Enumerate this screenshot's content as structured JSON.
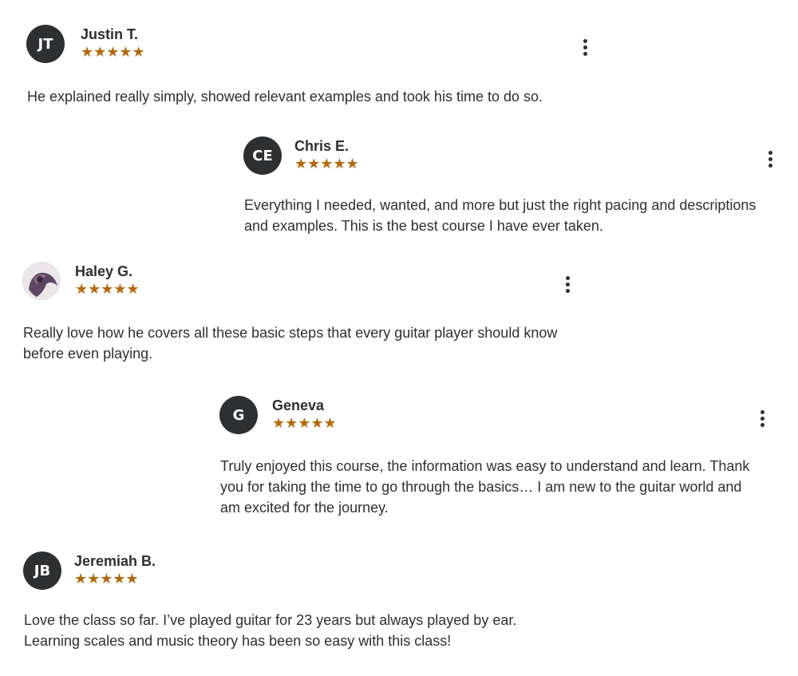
{
  "reviews": [
    {
      "initials": "JT",
      "name": "Justin T.",
      "rating": "★★★★★",
      "text": "He explained really simply, showed relevant examples and took his time to do so."
    },
    {
      "initials": "CE",
      "name": "Chris E.",
      "rating": "★★★★★",
      "text": "Everything I needed, wanted, and more but just the right pacing and descriptions\nand examples. This is the best course I have ever taken."
    },
    {
      "initials": "",
      "name": "Haley G.",
      "rating": "★★★★★",
      "text": "Really love how he covers all these basic steps that every guitar player should know\nbefore even playing."
    },
    {
      "initials": "G",
      "name": "Geneva",
      "rating": "★★★★★",
      "text": "Truly enjoyed this course, the information was easy to understand and learn. Thank\nyou for taking the time to go through the basics… I am new to the guitar world and\nam excited for the journey."
    },
    {
      "initials": "JB",
      "name": "Jeremiah B.",
      "rating": "★★★★★",
      "text": "Love the class so far. I’ve played guitar for 23 years but always played by ear.\nLearning scales and music theory has been so easy with this class!"
    }
  ],
  "rating_value": 5,
  "rating_max": 5,
  "colors": {
    "star": "#b4690e",
    "avatar_bg": "#2d2f31",
    "text": "#2d2f31"
  },
  "icons": {
    "menu": "more-vertical-icon",
    "star": "star-icon",
    "photo": "profile-photo"
  }
}
